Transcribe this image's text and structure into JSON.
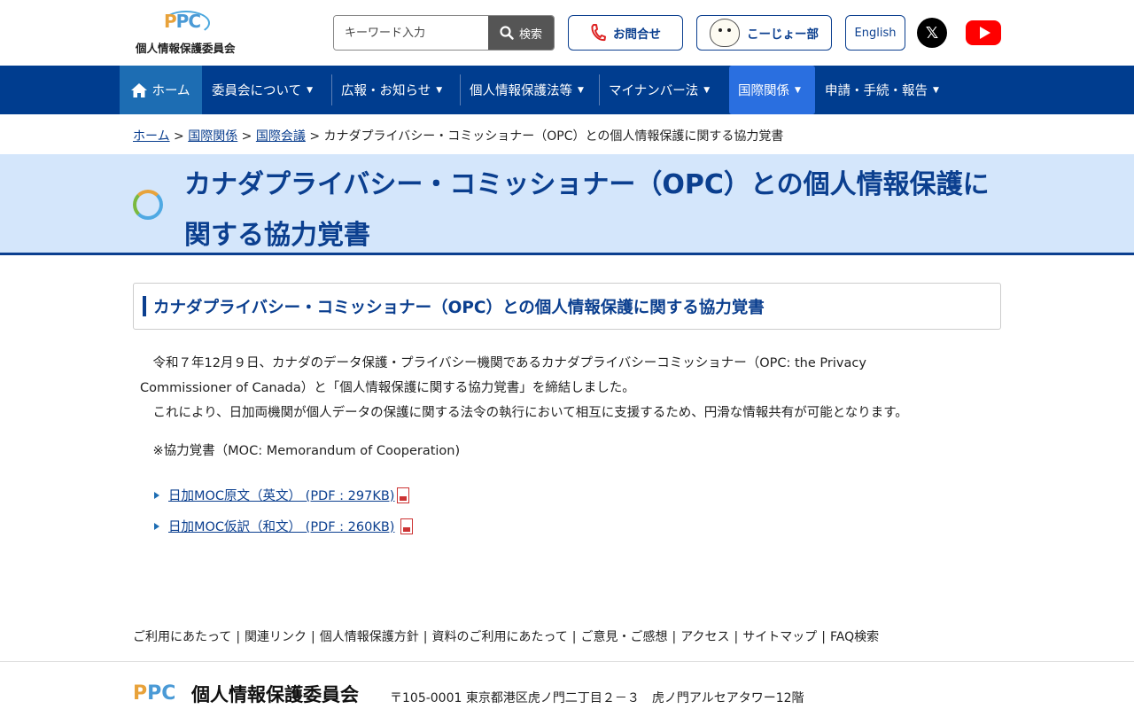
{
  "header": {
    "logo_mark_p": "P",
    "logo_mark_pc": "PC",
    "logo_text": "個人情報保護委員会",
    "search_placeholder": "キーワード入力",
    "search_label": "検索",
    "contact_label": "お問合せ",
    "kojo_label": "こーじょー部",
    "english_label": "English",
    "x_glyph": "𝕏"
  },
  "nav": {
    "home": "ホーム",
    "items": [
      "委員会について",
      "広報・お知らせ",
      "個人情報保護法等",
      "マイナンバー法",
      "国際関係",
      "申請・手続・報告"
    ],
    "caret": "▼"
  },
  "breadcrumb": {
    "home": "ホーム",
    "sep": " > ",
    "level1": "国際関係",
    "level2": "国際会議",
    "current": "カナダプライバシー・コミッショナー（OPC）との個人情報保護に関する協力覚書"
  },
  "page": {
    "title": "カナダプライバシー・コミッショナー（OPC）との個人情報保護に関する協力覚書",
    "section_heading": "カナダプライバシー・コミッショナー（OPC）との個人情報保護に関する協力覚書",
    "para1_line1": "　令和７年12月９日、カナダのデータ保護・プライバシー機関であるカナダプライバシーコミッショナー（OPC: the Privacy",
    "para1_line2": "Commissioner of Canada）と「個人情報保護に関する協力覚書」を締結しました。",
    "para2": "　これにより、日加両機関が個人データの保護に関する法令の執行において相互に支援するため、円滑な情報共有が可能となります。",
    "note": "　※協力覚書（MOC: Memorandum of Cooperation)",
    "links": [
      "日加MOC原文（英文） (PDF : 297KB)",
      "日加MOC仮訳（和文） (PDF : 260KB)"
    ]
  },
  "footer": {
    "links": [
      "ご利用にあたって",
      "関連リンク",
      "個人情報保護方針",
      "資料のご利用にあたって",
      "ご意見・ご感想",
      "アクセス",
      "サイトマップ",
      "FAQ検索"
    ],
    "sep": "|",
    "logo_p": "P",
    "logo_pc": "PC",
    "org_name": "個人情報保護委員会",
    "address": "〒105-0001 東京都港区虎ノ門二丁目２－３　虎ノ門アルセアタワー12階"
  },
  "colors": {
    "nav_bg": "#003d8f",
    "accent": "#0b3f8f",
    "title_band": "#d4e6fb",
    "nav_active": "#2a6fe0"
  }
}
